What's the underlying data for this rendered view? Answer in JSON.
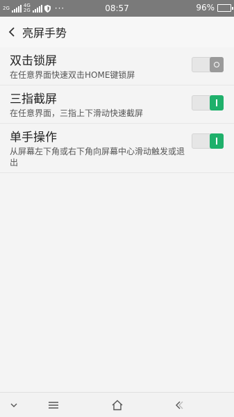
{
  "status_bar": {
    "network_labels": [
      "2G",
      "4G",
      "4G",
      "2G"
    ],
    "time": "08:57",
    "battery": "96%",
    "battery_level": 0.96,
    "more": "···"
  },
  "header": {
    "title": "亮屏手势"
  },
  "settings": [
    {
      "title": "双击锁屏",
      "description": "在任意界面快速双击HOME键锁屏",
      "enabled": false
    },
    {
      "title": "三指截屏",
      "description": "在任意界面，三指上下滑动快速截屏",
      "enabled": true
    },
    {
      "title": "单手操作",
      "description": "从屏幕左下角或右下角向屏幕中心滑动触发或退出",
      "enabled": true
    }
  ],
  "nav_bar": {
    "icons": [
      "chevron-down-icon",
      "menu-icon",
      "home-icon",
      "back-icon"
    ]
  },
  "colors": {
    "toggle_on": "#1fb06b",
    "toggle_off": "#9a9a9a",
    "status_bar": "#7a7a7a"
  }
}
